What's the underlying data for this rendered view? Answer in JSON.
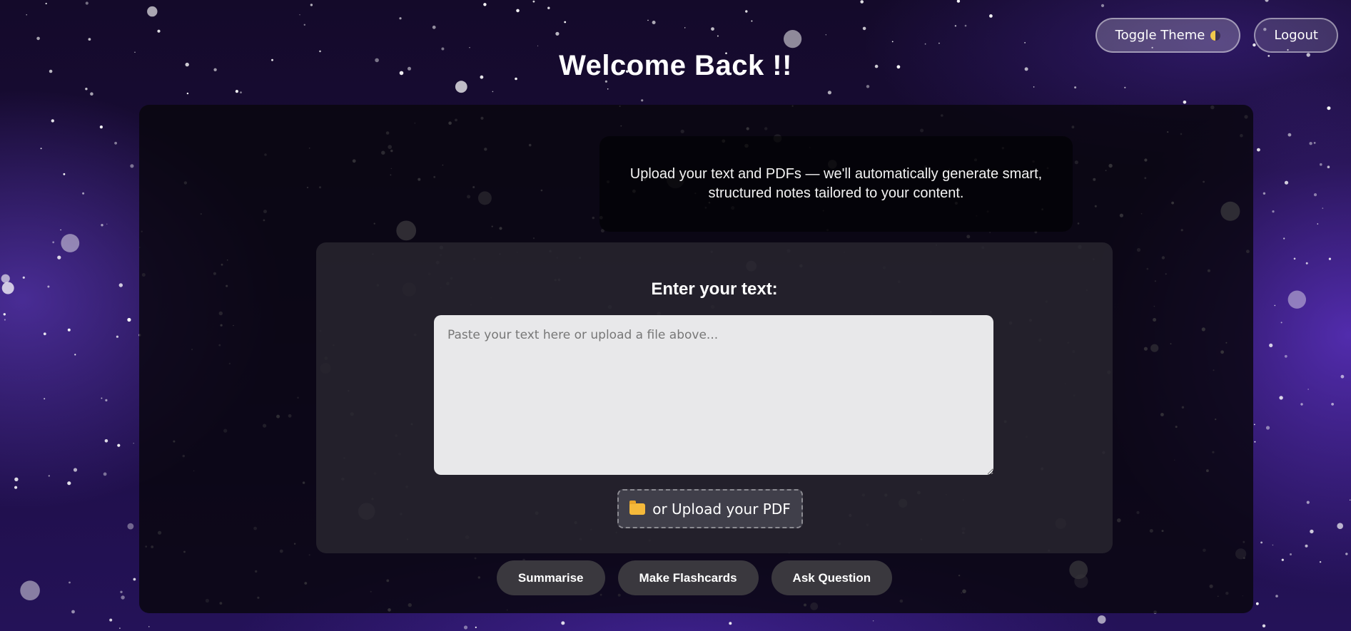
{
  "header": {
    "toggle_theme_label": "Toggle Theme",
    "logout_label": "Logout",
    "title": "Welcome Back !!"
  },
  "intro": {
    "text": "Upload your text and PDFs — we'll automatically generate smart, structured notes tailored to your content."
  },
  "input_card": {
    "heading": "Enter your text:",
    "textarea_placeholder": "Paste your text here or upload a file above...",
    "upload_label": "or Upload your PDF"
  },
  "actions": {
    "summarise": "Summarise",
    "flashcards": "Make Flashcards",
    "ask": "Ask Question"
  },
  "colors": {
    "background_top": "#140a2a",
    "background_glow": "#6e46dc",
    "panel": "#08060e",
    "card": "#282630",
    "button": "#3a383e",
    "folder": "#f5b93a"
  },
  "icons": [
    "moon-icon",
    "folder-icon"
  ]
}
